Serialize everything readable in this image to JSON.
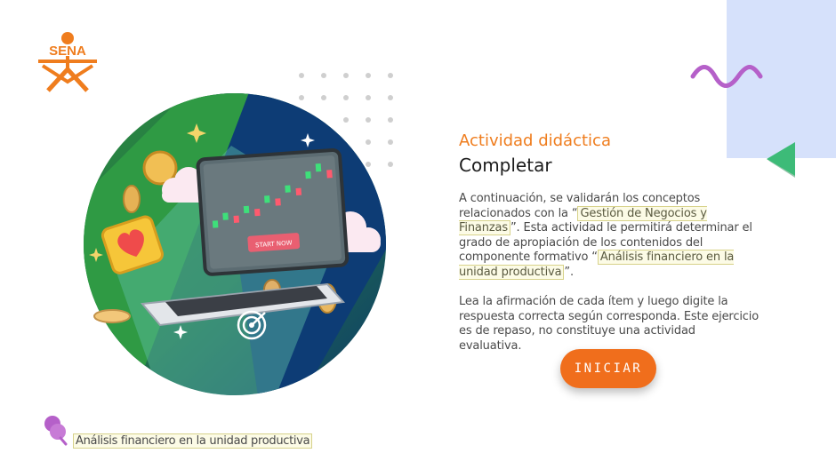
{
  "logo": {
    "text": "SENA",
    "color": "#ef7d1e"
  },
  "activity": {
    "eyebrow": "Actividad didáctica",
    "title": "Completar"
  },
  "intro": {
    "part1": "A continuación, se validarán los conceptos relacionados con la “",
    "highlight1": "Gestión de  Negocios y Finanzas",
    "part2": "”.  Esta actividad le permitirá determinar el grado de apropiación de los contenidos del componente formativo “",
    "highlight2": "Análisis financiero en la unidad productiva",
    "part3": "”."
  },
  "instructions": "Lea la afirmación de cada ítem y luego digite la respuesta correcta según corresponda.  Este ejercicio es de repaso, no constituye una actividad evaluativa.",
  "start_button": {
    "label": "INICIAR",
    "color": "#f06e1c"
  },
  "illustration": {
    "screen_button": "START NOW"
  },
  "footer": {
    "course_label": "Análisis financiero en la unidad productiva"
  },
  "colors": {
    "accent_orange": "#ef7d1e",
    "decor_blue": "#d6e1fb",
    "decor_purple": "#b560c9",
    "decor_green": "#3dbb78"
  }
}
